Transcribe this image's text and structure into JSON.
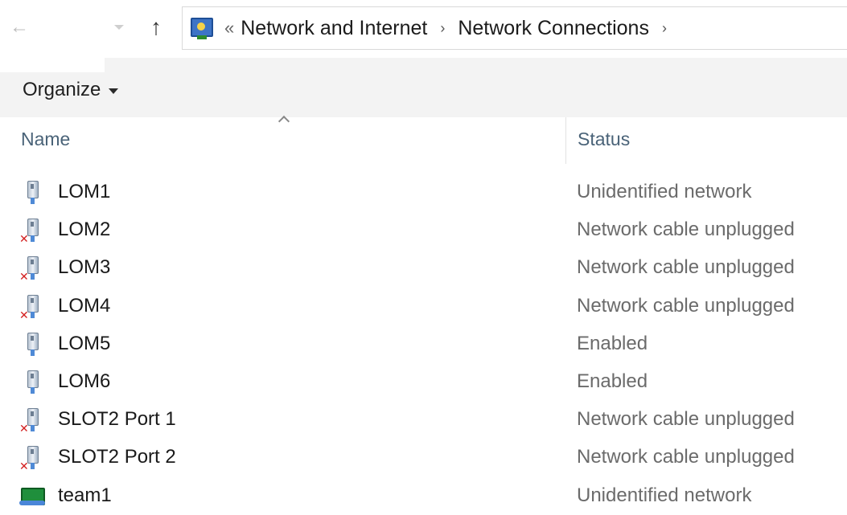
{
  "address_bar": {
    "breadcrumbs": [
      "Network and Internet",
      "Network Connections"
    ],
    "overflow_glyph": "«",
    "separator_glyph": "›",
    "back_icon": "back-arrow-icon",
    "forward_icon": "forward-arrow-icon",
    "up_icon": "up-arrow-icon",
    "location_icon": "network-center-icon"
  },
  "command_bar": {
    "organize_label": "Organize"
  },
  "columns": {
    "name": "Name",
    "status": "Status",
    "sorted_by": "name"
  },
  "connections": [
    {
      "name": "LOM1",
      "status": "Unidentified network",
      "icon": "network-adapter-icon",
      "disconnected": false
    },
    {
      "name": "LOM2",
      "status": "Network cable unplugged",
      "icon": "network-adapter-icon",
      "disconnected": true
    },
    {
      "name": "LOM3",
      "status": "Network cable unplugged",
      "icon": "network-adapter-icon",
      "disconnected": true
    },
    {
      "name": "LOM4",
      "status": "Network cable unplugged",
      "icon": "network-adapter-icon",
      "disconnected": true
    },
    {
      "name": "LOM5",
      "status": "Enabled",
      "icon": "network-adapter-icon",
      "disconnected": false
    },
    {
      "name": "LOM6",
      "status": "Enabled",
      "icon": "network-adapter-icon",
      "disconnected": false
    },
    {
      "name": "SLOT2 Port 1",
      "status": "Network cable unplugged",
      "icon": "network-adapter-icon",
      "disconnected": true
    },
    {
      "name": "SLOT2 Port 2",
      "status": "Network cable unplugged",
      "icon": "network-adapter-icon",
      "disconnected": true
    },
    {
      "name": "team1",
      "status": "Unidentified network",
      "icon": "team-adapter-icon",
      "disconnected": false
    }
  ],
  "colors": {
    "header_text": "#4a6378",
    "status_text": "#6b6b6b",
    "unplugged_mark": "#d32020",
    "command_bar_bg": "#f3f3f3"
  }
}
